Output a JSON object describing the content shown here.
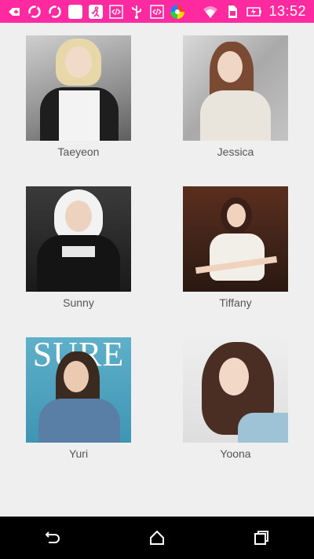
{
  "status_bar": {
    "time": "13:52",
    "left_icons": [
      "add-icon",
      "sync-icon",
      "sync-icon",
      "blank-app-icon",
      "run-icon",
      "code-icon",
      "usb-icon",
      "code-icon",
      "color-wheel-icon"
    ],
    "right_icons": [
      "wifi-icon",
      "sim-icon",
      "battery-charging-icon"
    ],
    "background": "#ff2aa0"
  },
  "grid": {
    "items": [
      {
        "name": "Taeyeon"
      },
      {
        "name": "Jessica"
      },
      {
        "name": "Sunny"
      },
      {
        "name": "Tiffany"
      },
      {
        "name": "Yuri"
      },
      {
        "name": "Yoona"
      }
    ]
  },
  "yuri_cover_text": "SURE",
  "nav_bar": {
    "buttons": [
      "back-icon",
      "home-icon",
      "recents-icon"
    ]
  }
}
